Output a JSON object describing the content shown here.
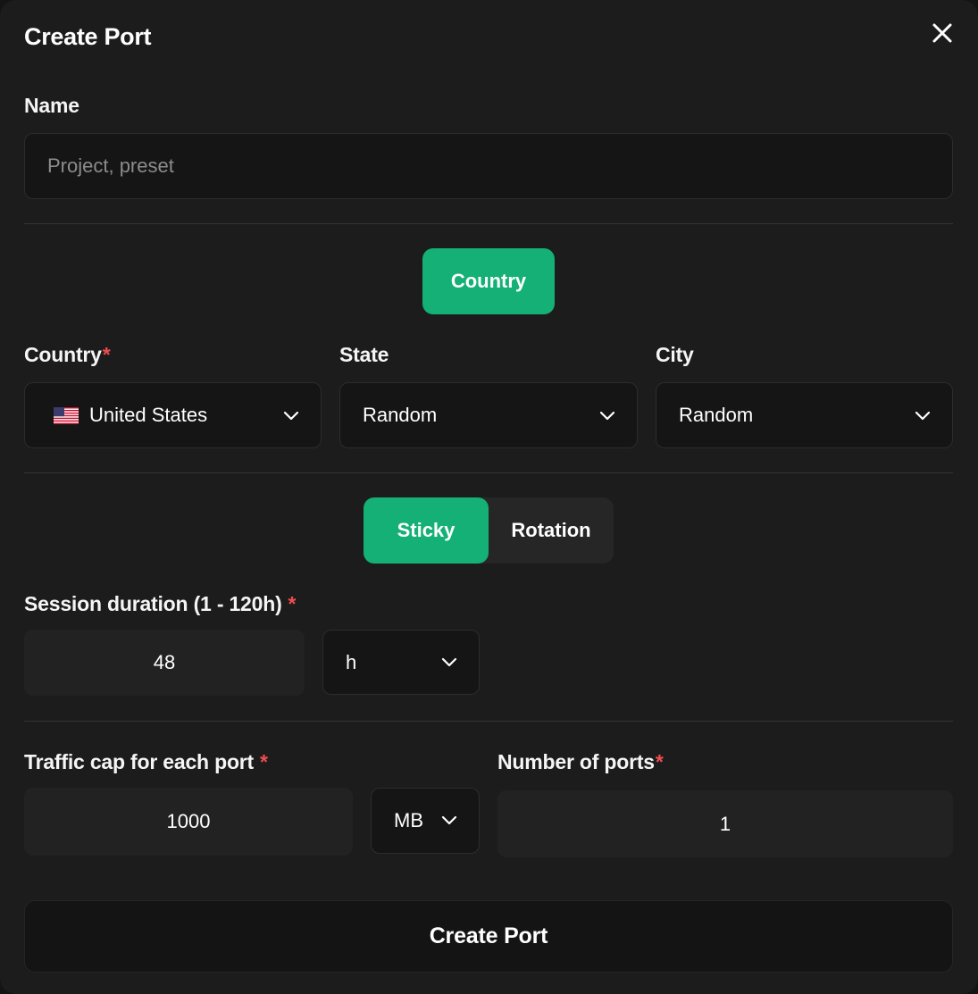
{
  "modal": {
    "title": "Create Port"
  },
  "name_field": {
    "label": "Name",
    "placeholder": "Project, preset",
    "value": ""
  },
  "location_mode": {
    "label": "Country"
  },
  "country": {
    "label": "Country",
    "required_mark": "*",
    "selected": "United States",
    "flag_icon": "us-flag-icon"
  },
  "state": {
    "label": "State",
    "selected": "Random"
  },
  "city": {
    "label": "City",
    "selected": "Random"
  },
  "session_type": {
    "options": [
      "Sticky",
      "Rotation"
    ],
    "selected": "Sticky"
  },
  "session_duration": {
    "label": "Session duration (1 - 120h)",
    "required_mark": "*",
    "value": "48",
    "unit": "h"
  },
  "traffic_cap": {
    "label": "Traffic cap for each port",
    "required_mark": "*",
    "value": "1000",
    "unit": "MB"
  },
  "ports": {
    "label": "Number of ports",
    "required_mark": "*",
    "value": "1"
  },
  "submit": {
    "label": "Create Port"
  },
  "colors": {
    "accent": "#14b075",
    "required": "#ef4e4e",
    "background": "#1c1c1c"
  }
}
